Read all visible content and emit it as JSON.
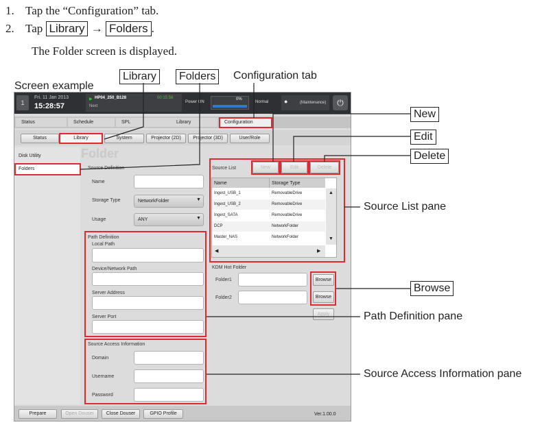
{
  "instructions": {
    "step1_num": "1.",
    "step1_text": "Tap the “Configuration” tab.",
    "step2_num": "2.",
    "step2_tap": "Tap",
    "step2_library": "Library",
    "step2_arrow": "→",
    "step2_folders": "Folders",
    "step2_period": ".",
    "step2_result": "The Folder screen is displayed."
  },
  "figure": {
    "screen_example": "Screen example",
    "top_library": "Library",
    "top_folders": "Folders",
    "top_config_tab": "Configuration tab",
    "callout_new": "New",
    "callout_edit": "Edit",
    "callout_delete": "Delete",
    "callout_source_list": "Source List pane",
    "callout_browse": "Browse",
    "callout_path_def": "Path Definition pane",
    "callout_source_access": "Source Access Information pane"
  },
  "app": {
    "header": {
      "date": "Fri. 11 Jan 2013",
      "time": "15:28:57",
      "show_title": "HP04_250_B128",
      "show_time": "00:15:56",
      "next": "Next",
      "power": "Power ON",
      "percent": "0%",
      "mode": "Normal",
      "user": "(Maintenance)",
      "progress_fraction": 0.0
    },
    "main_tabs": [
      "Status",
      "Schedule",
      "SPL",
      "Library",
      "Configuration"
    ],
    "sub_tabs": [
      "Status",
      "Library",
      "System",
      "Projector (2D)",
      "Projector (3D)",
      "User/Role"
    ],
    "side_items": [
      "Disk Utility",
      "Folders"
    ],
    "page_title": "Folder",
    "source_definition": {
      "title": "Source Definition",
      "name_label": "Name",
      "storage_type_label": "Storage Type",
      "storage_type_value": "NetworkFolder",
      "usage_label": "Usage",
      "usage_value": "ANY"
    },
    "path_definition": {
      "title": "Path Definition",
      "local_path": "Local Path",
      "device_path": "Device/Network Path",
      "server_address": "Server Address",
      "server_port": "Server Port"
    },
    "source_access": {
      "title": "Source Access Information",
      "domain": "Domain",
      "username": "Username",
      "password": "Password"
    },
    "source_list": {
      "title": "Source List",
      "new_btn": "New",
      "edit_btn": "Edit",
      "delete_btn": "Delete",
      "col_name": "Name",
      "col_storage": "Storage Type",
      "rows": [
        {
          "name": "Ingest_USB_1",
          "type": "RemovableDrive"
        },
        {
          "name": "Ingest_USB_2",
          "type": "RemovableDrive"
        },
        {
          "name": "Ingest_SATA",
          "type": "RemovableDrive"
        },
        {
          "name": "DCP",
          "type": "NetworkFolder"
        },
        {
          "name": "Master_NAS",
          "type": "NetworkFolder"
        }
      ]
    },
    "kdm": {
      "title": "KDM Hot Folder",
      "folder1": "Folder1",
      "folder2": "Folder2",
      "browse": "Browse",
      "apply": "Apply"
    },
    "footer": {
      "prepare": "Prepare",
      "open_douser": "Open Douser",
      "close_douser": "Close Douser",
      "gpio": "GPIO Profile",
      "version": "Ver.1.00.0"
    }
  }
}
